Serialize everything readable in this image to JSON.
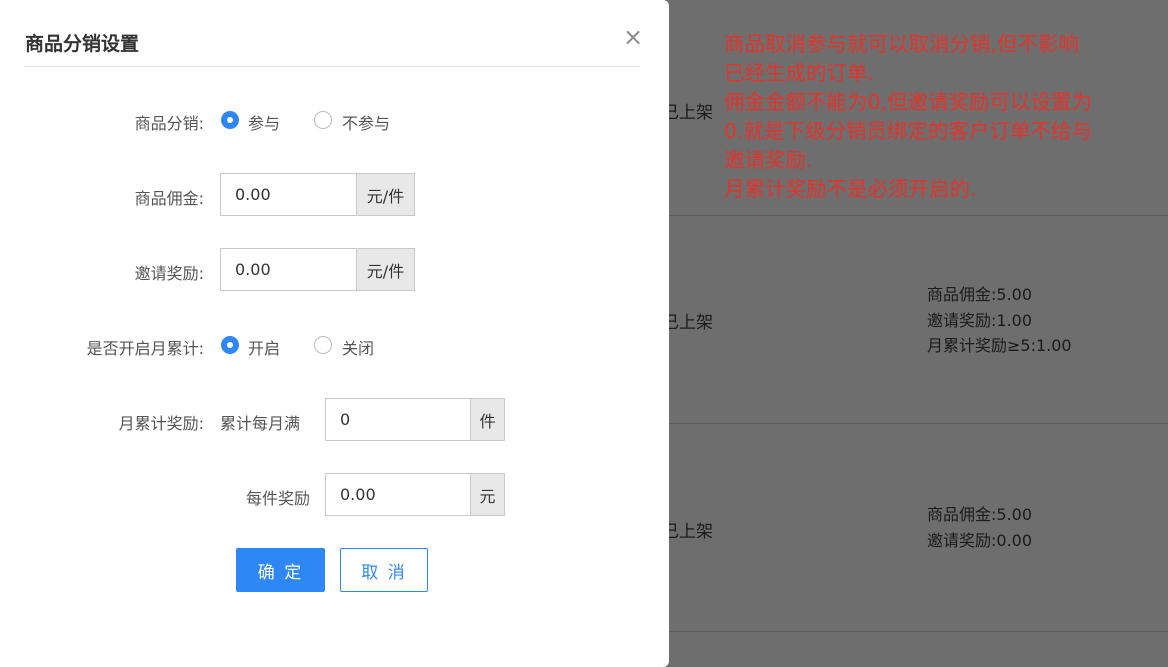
{
  "background": {
    "rows": [
      {
        "status": "已上架",
        "details": []
      },
      {
        "status": "已上架",
        "details": [
          "商品佣金:5.00",
          "邀请奖励:1.00",
          "月累计奖励≥5:1.00"
        ]
      },
      {
        "status": "已上架",
        "details": [
          "商品佣金:5.00",
          "邀请奖励:0.00"
        ]
      }
    ]
  },
  "annotation": {
    "lines": [
      "商品取消参与就可以取消分销,但不影响",
      "已经生成的订单.",
      "佣金金额不能为0,但邀请奖励可以设置为",
      "0.就是下级分销员绑定的客户订单不给与",
      "邀请奖励.",
      "月累计奖励不是必须开启的."
    ],
    "color": "#e6332a"
  },
  "dialog": {
    "title": "商品分销设置",
    "close_icon": "×",
    "distribution": {
      "label": "商品分销:",
      "options": [
        "参与",
        "不参与"
      ],
      "selected": "参与"
    },
    "commission": {
      "label": "商品佣金:",
      "value": "0.00",
      "unit": "元/件"
    },
    "invite_reward": {
      "label": "邀请奖励:",
      "value": "0.00",
      "unit": "元/件"
    },
    "monthly_toggle": {
      "label": "是否开启月累计:",
      "options": [
        "开启",
        "关闭"
      ],
      "selected": "开启"
    },
    "monthly_reward": {
      "label": "月累计奖励:",
      "threshold_prefix": "累计每月满",
      "threshold_value": "0",
      "threshold_unit": "件",
      "per_item_label": "每件奖励",
      "per_item_value": "0.00",
      "per_item_unit": "元"
    },
    "buttons": {
      "confirm": "确 定",
      "cancel": "取 消"
    },
    "accent_color": "#2f87f5"
  }
}
